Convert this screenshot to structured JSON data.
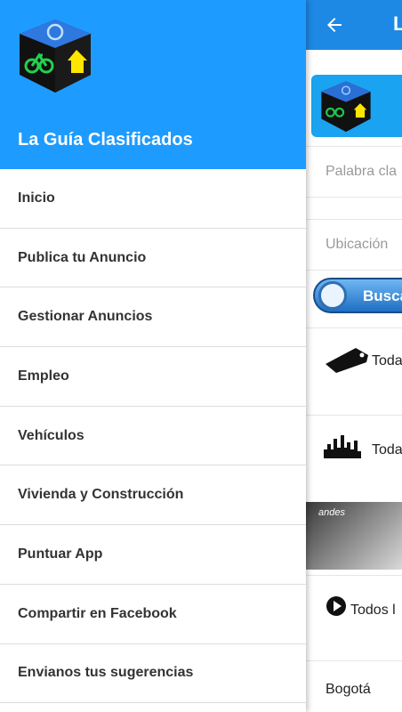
{
  "drawer": {
    "title": "La Guía Clasificados",
    "items": [
      {
        "label": "Inicio"
      },
      {
        "label": "Publica tu Anuncio"
      },
      {
        "label": "Gestionar Anuncios"
      },
      {
        "label": "Empleo"
      },
      {
        "label": "Vehículos"
      },
      {
        "label": "Vivienda y Construcción"
      },
      {
        "label": "Puntuar App"
      },
      {
        "label": "Compartir en Facebook"
      },
      {
        "label": "Envianos tus sugerencias"
      }
    ]
  },
  "appbar": {
    "title_partial": "L"
  },
  "search": {
    "keyword_placeholder": "Palabra cla",
    "location_placeholder": "Ubicación",
    "button_label": "Busca"
  },
  "categories": [
    {
      "label": "Toda",
      "icon": "price-tag-icon"
    },
    {
      "label": "Toda",
      "icon": "city-skyline-icon"
    },
    {
      "label": "Todos l",
      "icon": "play-circle-icon"
    }
  ],
  "promo": {
    "brand": "andes"
  },
  "location": {
    "city": "Bogotá"
  },
  "colors": {
    "header_blue": "#1e9bff",
    "appbar_blue": "#1e88e5"
  }
}
